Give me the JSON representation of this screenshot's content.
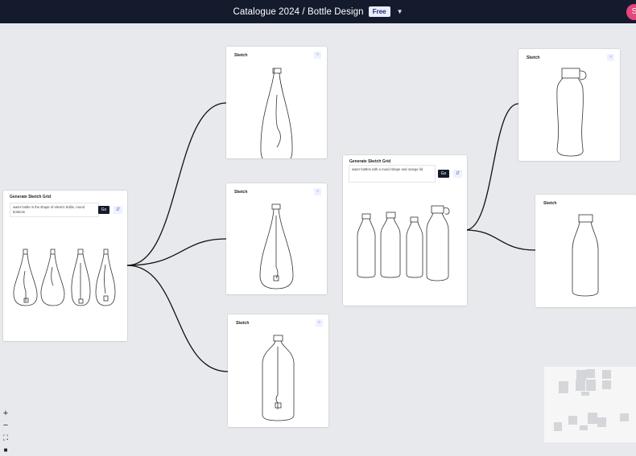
{
  "topbar": {
    "title": "Catalogue 2024 / Bottle Design",
    "badge": "Free",
    "avatar": "S"
  },
  "nodes": {
    "gen1": {
      "label": "Generate Sketch Grid",
      "prompt": "water bottle in the shape of electric bulbs, round bottoms",
      "go": "Go"
    },
    "gen2": {
      "label": "Generate Sketch Grid",
      "prompt": "water bottles with a round shape and orange lid",
      "go": "Go"
    },
    "sketch_label": "Sketch"
  },
  "zoom": {
    "in": "+",
    "out": "−",
    "fit": "⛶",
    "lock": "🔒"
  },
  "icons": {
    "pin": "pin-icon",
    "tune": "tune-icon",
    "chevron": "chevron-down-icon"
  }
}
